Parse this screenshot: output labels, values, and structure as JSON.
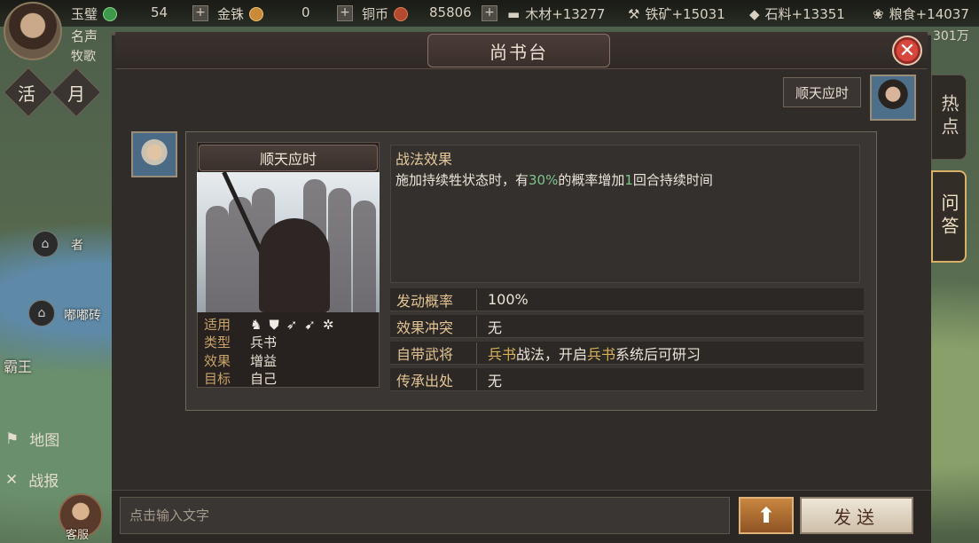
{
  "topbar": {
    "jade_label": "玉璧",
    "jade_value": "54",
    "gold_label": "金铢",
    "gold_value": "0",
    "copper_label": "铜币",
    "copper_value": "85806",
    "wood": "木材+13277",
    "iron": "铁矿+15031",
    "stone": "石料+13351",
    "grain": "粮食+14037",
    "grain_extra": "301万",
    "player_title": "名声",
    "player_name": "牧歌"
  },
  "left_side": {
    "tab1": "活",
    "tab2": "月",
    "map_label_1": "者",
    "map_label_2": "嘟嘟砖",
    "map_label_3": "霸王",
    "menu_map": "地图",
    "menu_report": "战报",
    "customer_service": "客服"
  },
  "modal": {
    "title": "尚书台",
    "side_tabs": [
      {
        "label": "热点",
        "active": false
      },
      {
        "label": "问答",
        "active": true
      }
    ],
    "speaker_bubble": "顺天应时"
  },
  "skill": {
    "name": "顺天应时",
    "attributes": [
      {
        "key": "适用",
        "value": ""
      },
      {
        "key": "类型",
        "value": "兵书"
      },
      {
        "key": "效果",
        "value": "增益"
      },
      {
        "key": "目标",
        "value": "自己"
      }
    ],
    "troop_icons": [
      "cavalry-icon",
      "shield-icon",
      "bow-icon",
      "spear-icon",
      "wheel-icon"
    ],
    "effect_title": "战法效果",
    "effect_desc_1": "施加持续牲状态时，有",
    "effect_pct": "30%",
    "effect_desc_2": "的概率增加",
    "effect_turns": "1",
    "effect_desc_3": "回合持续时间",
    "rows": [
      {
        "key": "发动概率",
        "value": "100%"
      },
      {
        "key": "效果冲突",
        "value": "无"
      },
      {
        "key": "自带武将",
        "value_a": "兵书",
        "value_b": "战法，开启",
        "value_c": "兵书",
        "value_d": "系统后可研习"
      },
      {
        "key": "传承出处",
        "value": "无"
      }
    ]
  },
  "chat": {
    "placeholder": "点击输入文字",
    "send_label": "发送"
  },
  "colors": {
    "accent_gold": "#d9b35a",
    "accent_green": "#7ec58a",
    "close_red": "#d8463c"
  }
}
